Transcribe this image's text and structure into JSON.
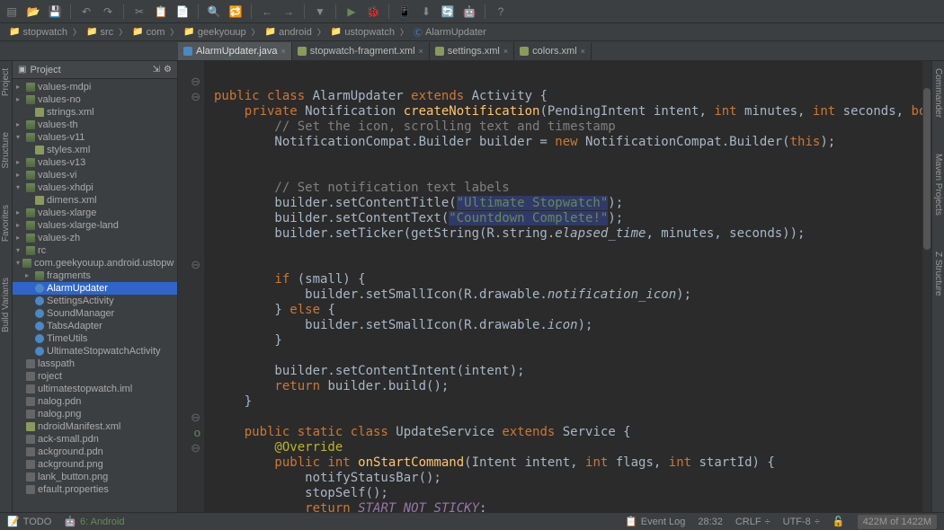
{
  "breadcrumbs": [
    "stopwatch",
    "src",
    "com",
    "geekyouup",
    "android",
    "ustopwatch",
    "AlarmUpdater"
  ],
  "tabs": [
    {
      "label": "AlarmUpdater.java",
      "type": "java",
      "close": "×",
      "active": true
    },
    {
      "label": "stopwatch-fragment.xml",
      "type": "xml",
      "close": "×",
      "active": false
    },
    {
      "label": "settings.xml",
      "type": "xml",
      "close": "×",
      "active": false
    },
    {
      "label": "colors.xml",
      "type": "xml",
      "close": "×",
      "active": false
    }
  ],
  "panel_header": "Project",
  "tree": [
    {
      "label": "values-mdpi",
      "cls": "folder",
      "ind": 0,
      "arrow": "▸"
    },
    {
      "label": "values-no",
      "cls": "folder",
      "ind": 0,
      "arrow": "▸"
    },
    {
      "label": "strings.xml",
      "cls": "xml",
      "ind": 1,
      "arrow": ""
    },
    {
      "label": "values-th",
      "cls": "folder",
      "ind": 0,
      "arrow": "▸"
    },
    {
      "label": "values-v11",
      "cls": "folder",
      "ind": 0,
      "arrow": "▾"
    },
    {
      "label": "styles.xml",
      "cls": "xml",
      "ind": 1,
      "arrow": ""
    },
    {
      "label": "values-v13",
      "cls": "folder",
      "ind": 0,
      "arrow": "▸"
    },
    {
      "label": "values-vi",
      "cls": "folder",
      "ind": 0,
      "arrow": "▸"
    },
    {
      "label": "values-xhdpi",
      "cls": "folder",
      "ind": 0,
      "arrow": "▾"
    },
    {
      "label": "dimens.xml",
      "cls": "xml",
      "ind": 1,
      "arrow": ""
    },
    {
      "label": "values-xlarge",
      "cls": "folder",
      "ind": 0,
      "arrow": "▸"
    },
    {
      "label": "values-xlarge-land",
      "cls": "folder",
      "ind": 0,
      "arrow": "▸"
    },
    {
      "label": "values-zh",
      "cls": "folder",
      "ind": 0,
      "arrow": "▸"
    },
    {
      "label": "rc",
      "cls": "folder",
      "ind": 0,
      "arrow": "▾"
    },
    {
      "label": "com.geekyouup.android.ustopw",
      "cls": "folder",
      "ind": 0,
      "arrow": "▾"
    },
    {
      "label": "fragments",
      "cls": "folder",
      "ind": 1,
      "arrow": "▸"
    },
    {
      "label": "AlarmUpdater",
      "cls": "cls",
      "ind": 1,
      "arrow": "",
      "sel": true
    },
    {
      "label": "SettingsActivity",
      "cls": "cls",
      "ind": 1,
      "arrow": ""
    },
    {
      "label": "SoundManager",
      "cls": "cls",
      "ind": 1,
      "arrow": ""
    },
    {
      "label": "TabsAdapter",
      "cls": "cls",
      "ind": 1,
      "arrow": ""
    },
    {
      "label": "TimeUtils",
      "cls": "cls",
      "ind": 1,
      "arrow": ""
    },
    {
      "label": "UltimateStopwatchActivity",
      "cls": "cls",
      "ind": 1,
      "arrow": ""
    },
    {
      "label": "lasspath",
      "cls": "file",
      "ind": 0,
      "arrow": ""
    },
    {
      "label": "roject",
      "cls": "file",
      "ind": 0,
      "arrow": ""
    },
    {
      "label": "ultimatestopwatch.iml",
      "cls": "file",
      "ind": 0,
      "arrow": ""
    },
    {
      "label": "nalog.pdn",
      "cls": "file",
      "ind": 0,
      "arrow": ""
    },
    {
      "label": "nalog.png",
      "cls": "file",
      "ind": 0,
      "arrow": ""
    },
    {
      "label": "ndroidManifest.xml",
      "cls": "xml",
      "ind": 0,
      "arrow": ""
    },
    {
      "label": "ack-small.pdn",
      "cls": "file",
      "ind": 0,
      "arrow": ""
    },
    {
      "label": "ackground.pdn",
      "cls": "file",
      "ind": 0,
      "arrow": ""
    },
    {
      "label": "ackground.png",
      "cls": "file",
      "ind": 0,
      "arrow": ""
    },
    {
      "label": "lank_button.png",
      "cls": "file",
      "ind": 0,
      "arrow": ""
    },
    {
      "label": "efault.properties",
      "cls": "file",
      "ind": 0,
      "arrow": ""
    }
  ],
  "left_sidebar": [
    "Project",
    "Structure",
    "Favorites",
    "Build Variants"
  ],
  "right_sidebar": [
    "Commander",
    "Maven Projects",
    "Z Structure"
  ],
  "code": {
    "l1_public": "public ",
    "l1_class": "class ",
    "l1_name": "AlarmUpdater ",
    "l1_ext": "extends ",
    "l1_act": "Activity {",
    "l2_priv": "    private ",
    "l2_type": "Notification ",
    "l2_m": "createNotification",
    "l2_sig": "(PendingIntent intent, ",
    "l2_int": "int",
    "l2_min": " minutes, ",
    "l2_sec": " seconds, ",
    "l2_boo": "boo",
    "cmt1": "        // Set the icon, scrolling text and timestamp",
    "l4_a": "        NotificationCompat.Builder builder = ",
    "l4_new": "new ",
    "l4_b": "NotificationCompat.Builder(",
    "l4_this": "this",
    "l4_c": ");",
    "cmt2": "        // Set notification text labels",
    "l8_a": "        builder.setContentTitle(",
    "l8_s": "\"Ultimate Stopwatch\"",
    "l8_b": ");",
    "l9_a": "        builder.setContentText(",
    "l9_s": "\"Countdown Complete!\"",
    "l9_b": ");",
    "l10_a": "        builder.setTicker(getString(R.string.",
    "l10_i": "elapsed_time",
    "l10_b": ", minutes, seconds));",
    "l13_if": "        if ",
    "l13_b": "(small) {",
    "l14_a": "            builder.setSmallIcon(R.drawable.",
    "l14_i": "notification_icon",
    "l14_b": ");",
    "l15": "        } ",
    "l15_else": "else ",
    "l15_b": "{",
    "l16_a": "            builder.setSmallIcon(R.drawable.",
    "l16_i": "icon",
    "l16_b": ");",
    "l17": "        }",
    "l19": "        builder.setContentIntent(intent);",
    "l20_r": "        return ",
    "l20_b": "builder.build();",
    "l21": "    }",
    "l23_ps": "    public static ",
    "l23_cls": "class ",
    "l23_n": "UpdateService ",
    "l23_ext": "extends ",
    "l23_svc": "Service {",
    "l24": "        @Override",
    "l25_p": "        public ",
    "l25_int": "int ",
    "l25_m": "onStartCommand",
    "l25_sig": "(Intent intent, ",
    "l25_k": "int",
    "l25_f": " flags, ",
    "l25_s": " startId) {",
    "l26": "            notifyStatusBar();",
    "l27": "            stopSelf();",
    "l28_r": "            return ",
    "l28_v": "START_NOT_STICKY",
    "l28_e": ";"
  },
  "status": {
    "todo": "TODO",
    "android": "6: Android",
    "event": "Event Log",
    "pos": "28:32",
    "crlf": "CRLF",
    "enc": "UTF-8",
    "mem": "422M of 1422M"
  }
}
